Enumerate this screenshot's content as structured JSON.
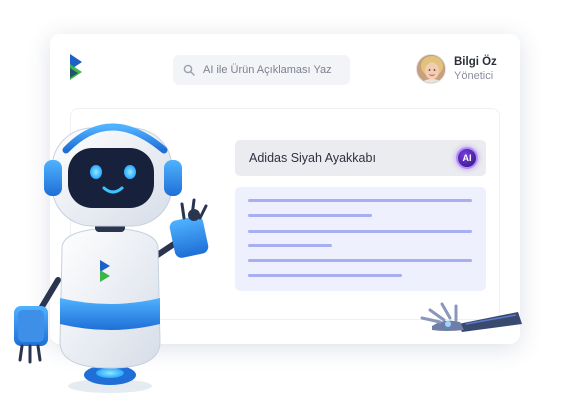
{
  "search": {
    "placeholder": "AI ile Ürün Açıklaması Yaz",
    "icon": "search-icon"
  },
  "user": {
    "name": "Bilgi Öz",
    "role": "Yönetici"
  },
  "product": {
    "title": "Adidas Siyah Ayakkabı",
    "ai_badge": "AI"
  },
  "colors": {
    "accent": "#2d8cf0",
    "brand_blue": "#1f5fc8",
    "brand_green": "#39b54a",
    "description_lines": "#a8aef2",
    "ai_badge": "#5a2bc4"
  }
}
